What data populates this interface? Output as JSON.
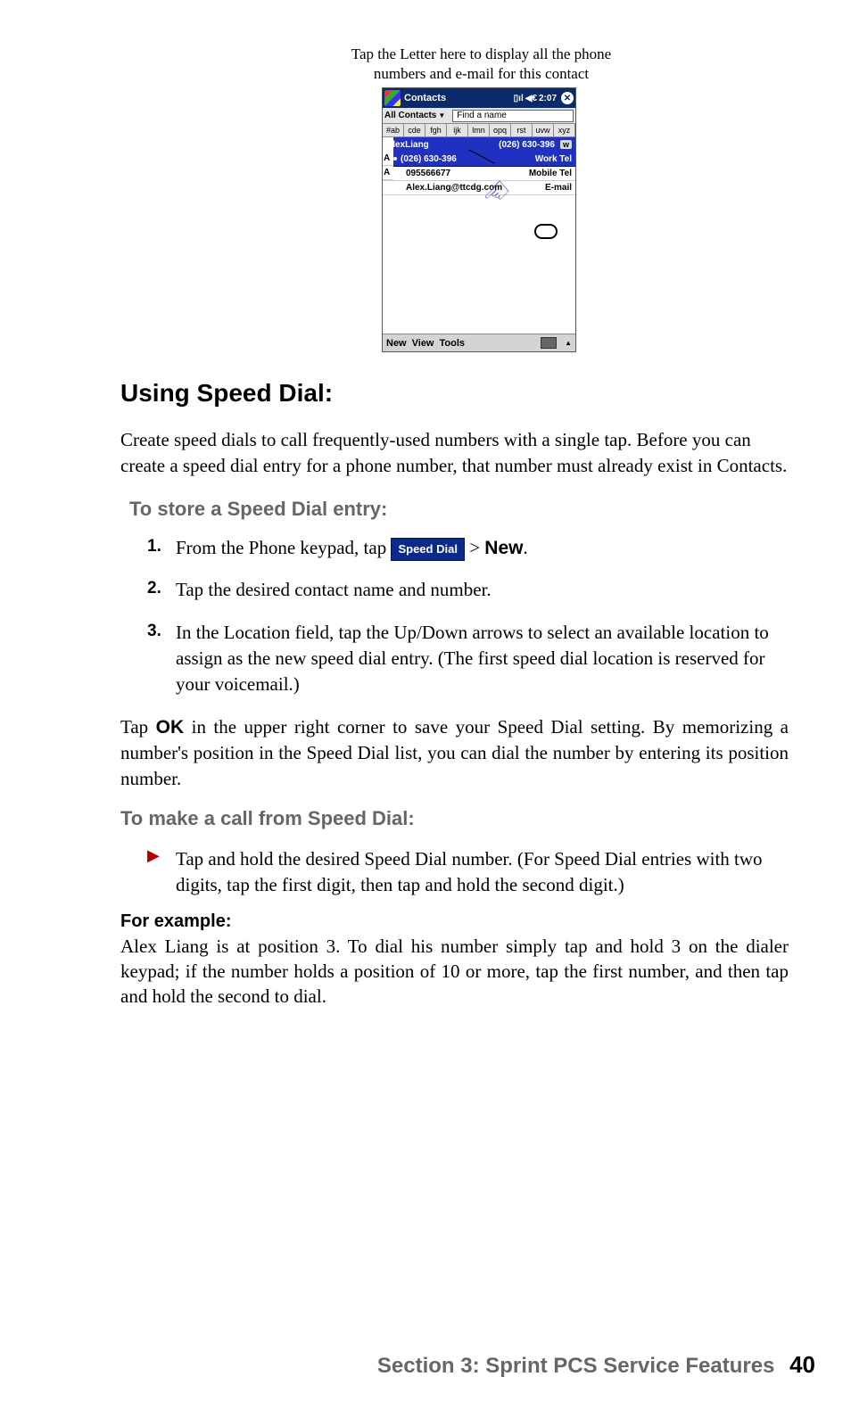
{
  "caption": {
    "line1": "Tap the Letter here to display all the phone",
    "line2": "numbers and e-mail for this contact"
  },
  "device": {
    "title": "Contacts",
    "time": "2:07",
    "filter_label": "All Contacts",
    "find_placeholder": "Find a name",
    "alpha_tabs": [
      "#ab",
      "cde",
      "fgh",
      "ijk",
      "lmn",
      "opq",
      "rst",
      "uvw",
      "xyz"
    ],
    "selected_contact": {
      "name": "AlexLiang",
      "phone": "(026) 630-396",
      "tag": "w"
    },
    "quickmenu": {
      "phone": "(026) 630-396",
      "label": "Work Tel"
    },
    "details": [
      {
        "value": "095566677",
        "label": "Mobile Tel"
      },
      {
        "value": "Alex.Liang@ttcdg.com",
        "label": "E-mail"
      }
    ],
    "partial_rows": [
      "A",
      "A"
    ],
    "menu": {
      "new": "New",
      "view": "View",
      "tools": "Tools"
    }
  },
  "heading": "Using Speed Dial:",
  "intro": "Create speed dials to call frequently-used numbers with a single tap. Before you can create a speed dial entry for a phone number, that number must already exist in Contacts.",
  "store_heading": "To store a Speed Dial entry:",
  "steps": {
    "s1_a": "From the Phone keypad, tap ",
    "s1_button": "Speed Dial",
    "s1_b": " > ",
    "s1_c": "New",
    "s1_d": ".",
    "s2": "Tap the desired contact name and number.",
    "s3": "In the Location field, tap the Up/Down arrows to select an available location to assign as the new speed dial entry.  (The first speed dial location is reserved for your voicemail.)"
  },
  "tap_ok_a": "Tap ",
  "tap_ok_b": "OK",
  "tap_ok_c": " in the upper right corner to save your Speed Dial setting. By memorizing a number's position in the Speed Dial list, you can dial the number by entering its position number.",
  "make_heading": "To make a call from Speed Dial:",
  "bullet": "Tap and hold the desired Speed Dial number. (For Speed Dial entries with two digits, tap the first digit, then tap and hold the second digit.)",
  "example_heading": "For example:",
  "example_body": "Alex Liang is at position 3. To dial his number simply tap and hold 3 on the dialer keypad; if the number holds a position of 10 or more, tap the first number, and then tap and hold the second to dial.",
  "footer_section": "Section 3: Sprint PCS Service Features",
  "footer_page": "40"
}
